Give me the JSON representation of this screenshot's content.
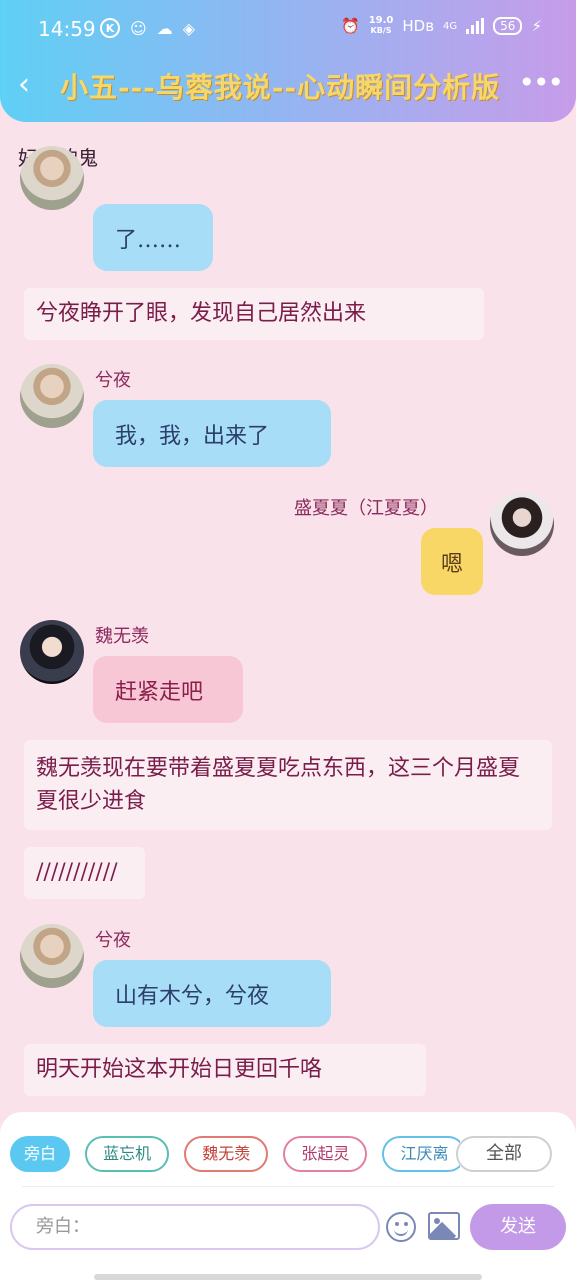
{
  "status_bar": {
    "time": "14:59",
    "left_icons": [
      "k-app-icon",
      "qq-icon",
      "wechat-icon",
      "layers-icon"
    ],
    "net_speed_value": "19.0",
    "net_speed_unit": "KB/S",
    "hd_label": "HDв",
    "network_label": "4G",
    "battery": "56"
  },
  "header": {
    "back_icon": "back-arrow-icon",
    "title": "小五---乌蓉我说--心动瞬间分析版",
    "more_icon": "more-dots-icon",
    "gradient_colors": [
      "#5fd0f5",
      "#c79ce9"
    ],
    "title_color": "#f4d86b"
  },
  "chat": {
    "section_label": "好凶的鬼",
    "messages": [
      {
        "type": "bubble",
        "sender": "",
        "text": "了……",
        "style": "blue"
      },
      {
        "type": "narration",
        "text": "兮夜睁开了眼，发现自己居然出来"
      },
      {
        "type": "bubble",
        "sender": "兮夜",
        "text": "我，我，出来了",
        "style": "blue"
      },
      {
        "type": "bubble",
        "sender": "盛夏夏（江夏夏）",
        "text": "嗯",
        "style": "yellow"
      },
      {
        "type": "bubble",
        "sender": "魏无羡",
        "text": "赶紧走吧",
        "style": "pink"
      },
      {
        "type": "narration",
        "text": "魏无羡现在要带着盛夏夏吃点东西，这三个月盛夏夏很少进食"
      },
      {
        "type": "narration",
        "text": "///////////"
      },
      {
        "type": "bubble",
        "sender": "兮夜",
        "text": "山有木兮，兮夜",
        "style": "blue"
      },
      {
        "type": "narration",
        "text": "明天开始这本开始日更回千咯"
      }
    ]
  },
  "bottom_panel": {
    "chips": [
      "旁白",
      "蓝忘机",
      "魏无羡",
      "张起灵",
      "江厌离"
    ],
    "all_button": "全部",
    "input_placeholder": "旁白：",
    "emoji_icon": "emoji-icon",
    "image_icon": "image-icon",
    "send_label": "发送",
    "send_color": "#c39ae8"
  }
}
